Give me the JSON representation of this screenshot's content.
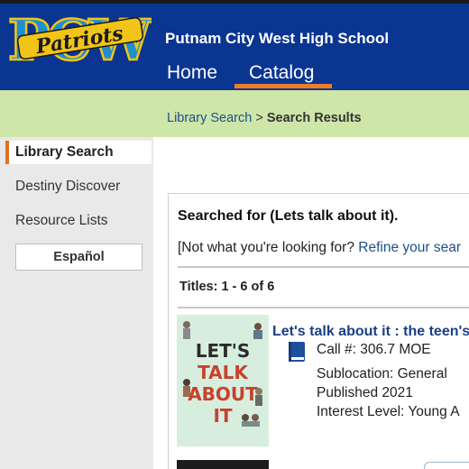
{
  "header": {
    "logo_text": "Patriots",
    "logo_letters": "PCW",
    "school_name": "Putnam City West High School",
    "nav": [
      {
        "label": "Home"
      },
      {
        "label": "Catalog",
        "active": true
      }
    ]
  },
  "breadcrumb": {
    "link": "Library Search",
    "separator": " > ",
    "current": "Search Results"
  },
  "sidebar": {
    "active_item": "Library Search",
    "items": [
      {
        "label": "Destiny Discover"
      },
      {
        "label": "Resource Lists"
      }
    ],
    "language_button": "Español"
  },
  "results": {
    "searched_for": "Searched for (Lets talk about it).",
    "not_looking_prefix": "[Not what you're looking for? ",
    "refine_link": "Refine your sear",
    "titles_count": "Titles: 1 - 6 of 6",
    "items": [
      {
        "title": "Let's talk about it : the teen's",
        "call_number": "Call #: 306.7 MOE",
        "sublocation": "Sublocation: General",
        "published": "Published 2021",
        "interest_level": "Interest Level: Young A",
        "cover": {
          "title_lines": [
            "LET'S",
            "TALK",
            "ABOUT",
            "IT"
          ]
        }
      }
    ]
  },
  "colors": {
    "header_bg": "#0a3591",
    "nav_underline": "#f07c24",
    "breadcrumb_bg": "#cfe6a9",
    "sidebar_bg": "#e9e9e9",
    "link": "#1f4f8a",
    "title_link": "#1a3f86",
    "active_marker": "#e1711f"
  },
  "icons": {
    "material_type": "book-icon"
  }
}
